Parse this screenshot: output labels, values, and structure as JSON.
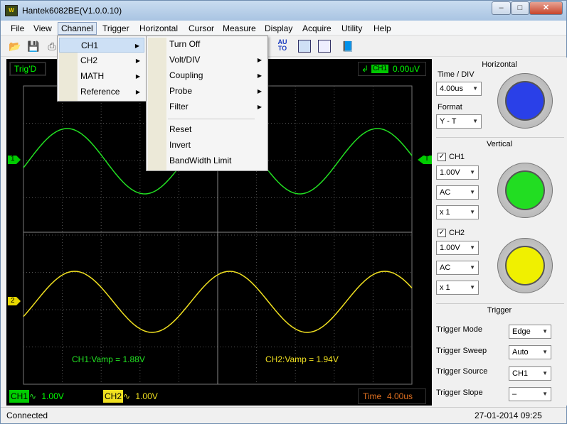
{
  "window": {
    "title": "Hantek6082BE(V1.0.0.10)",
    "min": "–",
    "max": "□",
    "close": "✕"
  },
  "menubar": [
    "File",
    "View",
    "Channel",
    "Trigger",
    "Horizontal",
    "Cursor",
    "Measure",
    "Display",
    "Acquire",
    "Utility",
    "Help"
  ],
  "toolbar": {
    "auto_label": "AU\nTO"
  },
  "scope": {
    "trig_status": "Trig'D",
    "trig_channel": "CH1",
    "trig_level": "0.00uV",
    "ch1_marker": "1",
    "ch2_marker": "2",
    "trig_marker": "T",
    "ch1_measure": "CH1:Vamp = 1.88V",
    "ch2_measure": "CH2:Vamp = 1.94V",
    "ch1_badge": "CH1",
    "ch1_volts": "1.00V",
    "ch2_badge": "CH2",
    "ch2_volts": "1.00V",
    "time_label": "Time",
    "time_value": "4.00us",
    "colors": {
      "ch1": "#22e022",
      "ch2": "#f0e020",
      "grid": "#555555"
    }
  },
  "horizontal": {
    "title": "Horizontal",
    "time_div_label": "Time / DIV",
    "time_div_value": "4.00us",
    "format_label": "Format",
    "format_value": "Y - T",
    "knob_color": "#2a40e8"
  },
  "vertical": {
    "title": "Vertical",
    "ch1": {
      "label": "CH1",
      "checked": "✓",
      "volts": "1.00V",
      "coupling": "AC",
      "probe": "x 1",
      "knob_color": "#22dd22"
    },
    "ch2": {
      "label": "CH2",
      "checked": "✓",
      "volts": "1.00V",
      "coupling": "AC",
      "probe": "x 1",
      "knob_color": "#f0f000"
    }
  },
  "trigger": {
    "title": "Trigger",
    "mode_label": "Trigger Mode",
    "mode_value": "Edge",
    "sweep_label": "Trigger Sweep",
    "sweep_value": "Auto",
    "source_label": "Trigger Source",
    "source_value": "CH1",
    "slope_label": "Trigger Slope",
    "slope_value": "–"
  },
  "status": {
    "left": "Connected",
    "right": "27-01-2014 09:25"
  },
  "channel_menu": [
    "CH1",
    "CH2",
    "MATH",
    "Reference"
  ],
  "ch1_submenu": [
    "Turn Off",
    "Volt/DIV",
    "Coupling",
    "Probe",
    "Filter",
    "Reset",
    "Invert",
    "BandWidth Limit"
  ]
}
